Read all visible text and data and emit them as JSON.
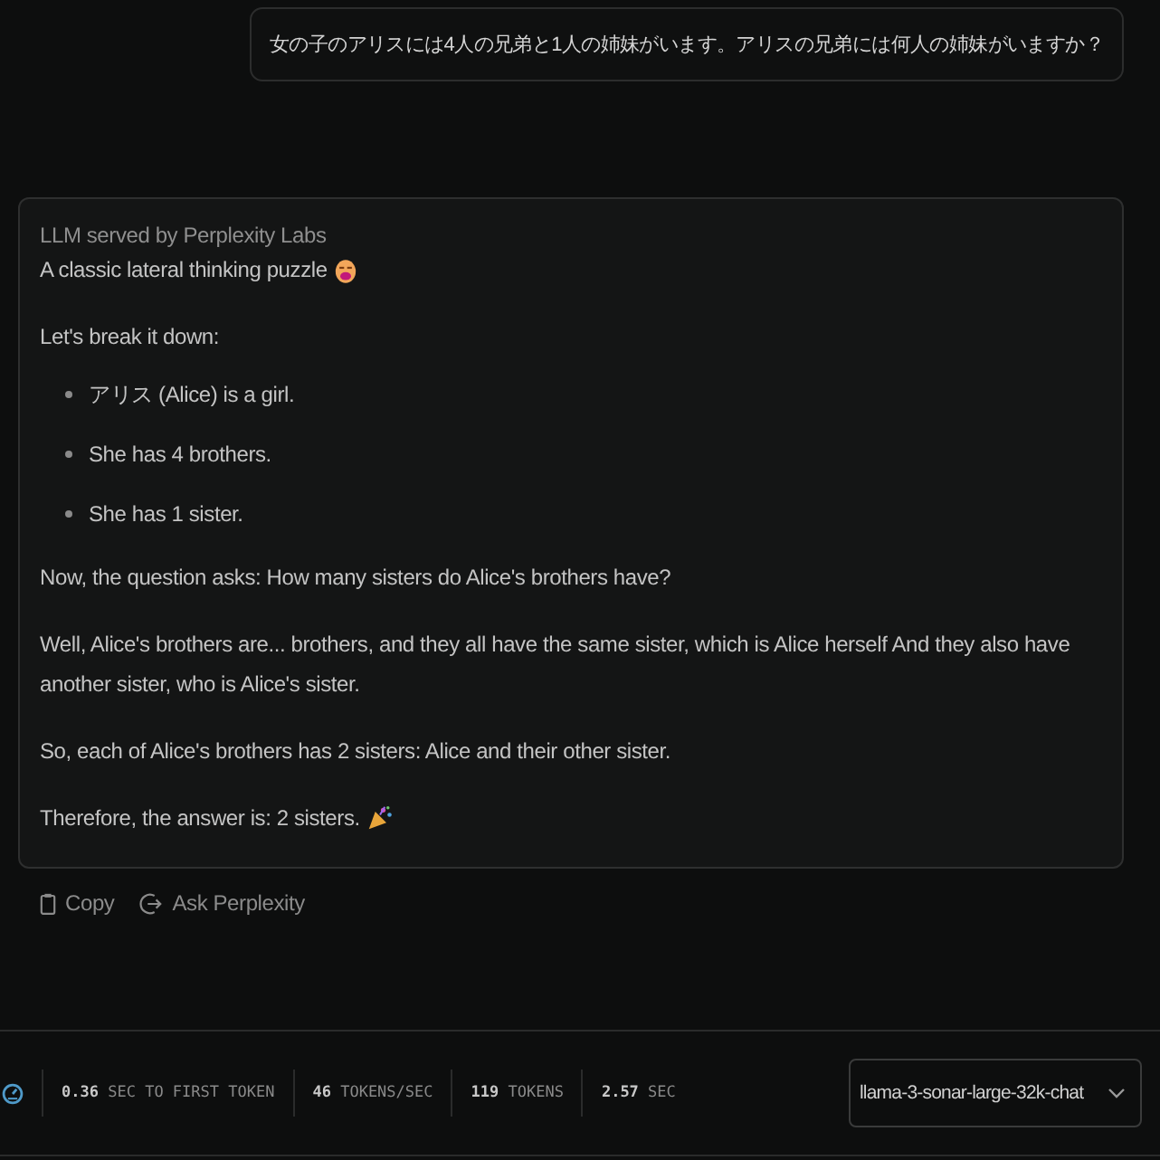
{
  "question": {
    "text": "女の子のアリスには4人の兄弟と1人の姉妹がいます。アリスの兄弟には何人の姉妹がいますか？"
  },
  "answer": {
    "source": "LLM served by Perplexity Labs",
    "blocks": [
      {
        "kind": "opener",
        "text": "A classic lateral thinking puzzle"
      },
      {
        "kind": "paragraph",
        "text": "Let's break it down:"
      },
      {
        "kind": "list",
        "items": [
          "アリス (Alice) is a girl.",
          "She has 4 brothers.",
          "She has 1 sister."
        ]
      },
      {
        "kind": "paragraph",
        "text": "Now, the question asks: How many sisters do Alice's brothers have?"
      },
      {
        "kind": "paragraph",
        "text": "Well, Alice's brothers are... brothers, and they all have the same sister, which is Alice herself And they also have another sister, who is Alice's sister."
      },
      {
        "kind": "paragraph",
        "text": "So, each of Alice's brothers has 2 sisters: Alice and their other sister."
      },
      {
        "kind": "closer",
        "text": "Therefore, the answer is: 2 sisters."
      }
    ]
  },
  "actions": [
    {
      "kind": "copy",
      "label": "Copy"
    },
    {
      "kind": "ask",
      "label": "Ask Perplexity"
    }
  ],
  "stats": [
    {
      "value": "0.36",
      "unit": "SEC TO FIRST TOKEN"
    },
    {
      "value": "46",
      "unit": "TOKENS/SEC"
    },
    {
      "value": "119",
      "unit": "TOKENS"
    },
    {
      "value": "2.57",
      "unit": "SEC"
    }
  ],
  "model_select": {
    "value": "llama-3-sonar-large-32k-chat"
  }
}
